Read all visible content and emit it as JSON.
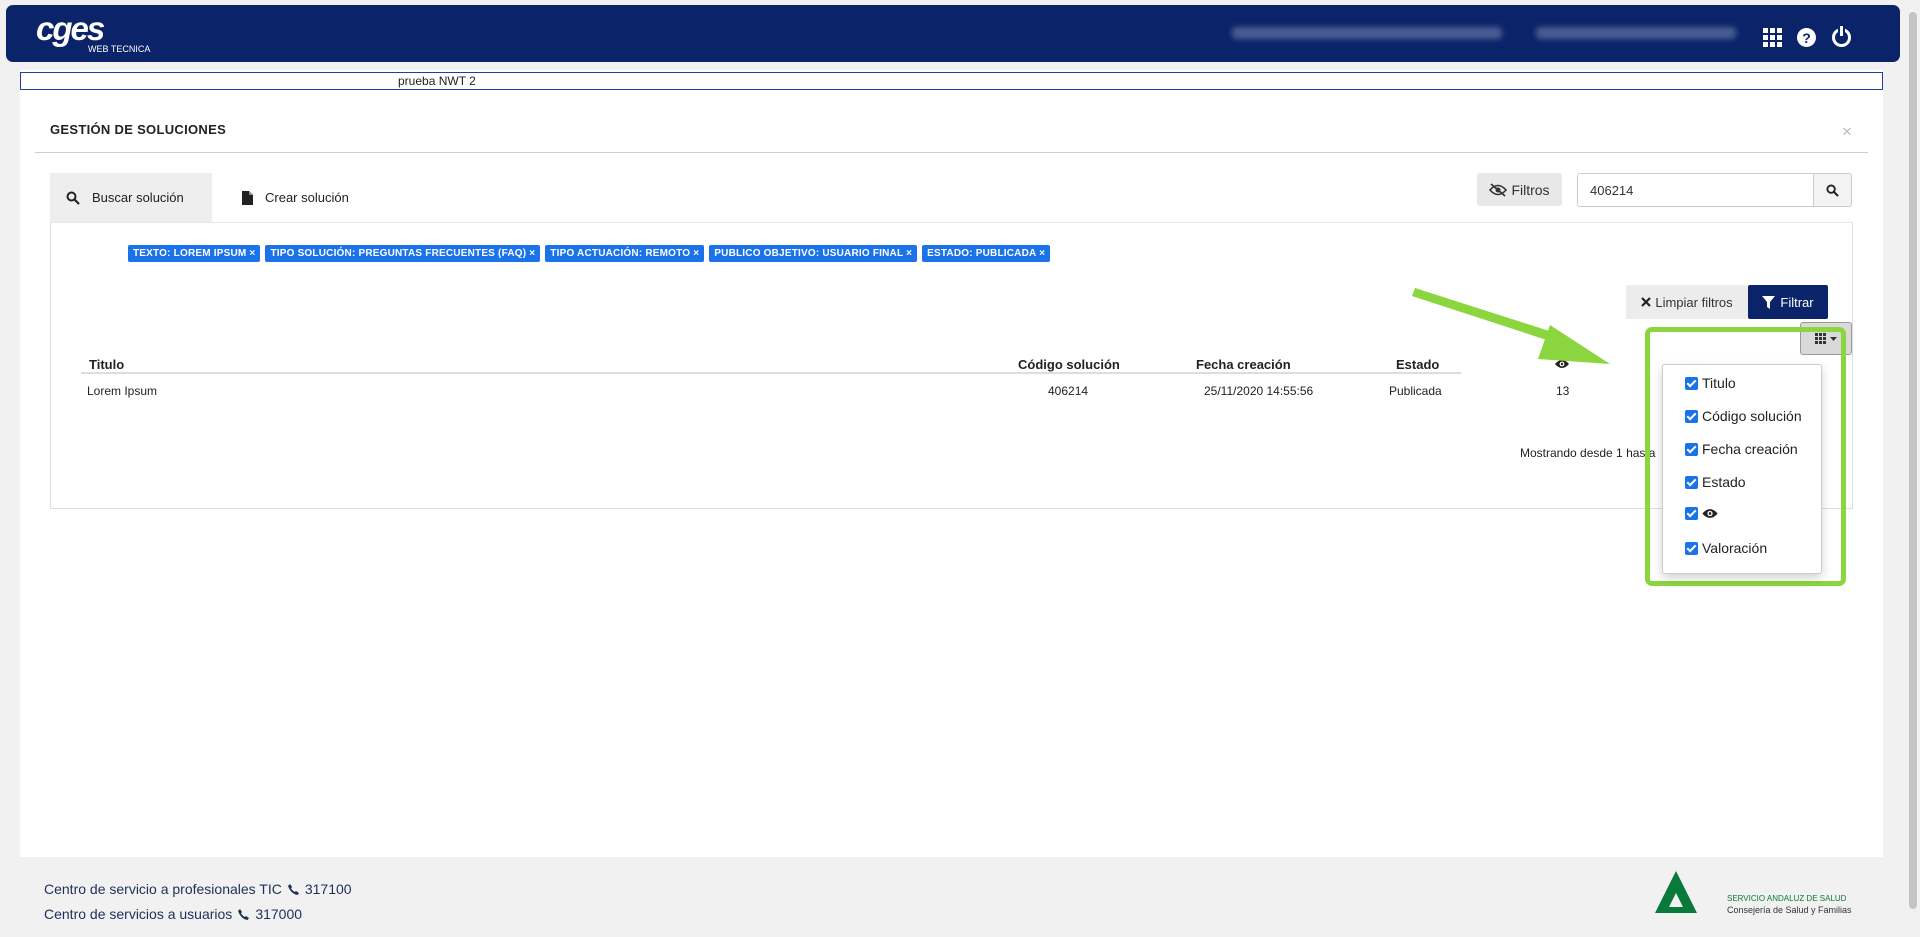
{
  "header": {
    "logo_text": "cges",
    "logo_sub": "WEB TECNICA",
    "icons": [
      "apps-grid-icon",
      "help-icon",
      "power-icon"
    ]
  },
  "tab_banner": "prueba NWT 2",
  "page": {
    "title": "GESTIÓN DE SOLUCIONES",
    "close": "×"
  },
  "tabs": [
    {
      "label": "Buscar solución",
      "icon": "search-icon",
      "active": true
    },
    {
      "label": "Crear solución",
      "icon": "file-icon",
      "active": false
    }
  ],
  "search": {
    "filters_label": "Filtros",
    "value": "406214"
  },
  "chips": [
    "TEXTO: LOREM IPSUM",
    "TIPO SOLUCIÓN: PREGUNTAS FRECUENTES (FAQ)",
    "TIPO ACTUACIÓN: REMOTO",
    "PUBLICO OBJETIVO: USUARIO FINAL",
    "ESTADO: PUBLICADA"
  ],
  "chip_close": "×",
  "actions": {
    "clear_label": "Limpiar filtros",
    "filter_label": "Filtrar"
  },
  "table": {
    "headers": [
      "Titulo",
      "Código solución",
      "Fecha creación",
      "Estado",
      ""
    ],
    "rows": [
      [
        "Lorem Ipsum",
        "406214",
        "25/11/2020 14:55:56",
        "Publicada",
        "13"
      ]
    ],
    "showing": "Mostrando desde 1 hasta"
  },
  "column_menu": [
    {
      "label": "Titulo",
      "checked": true
    },
    {
      "label": "Código solución",
      "checked": true
    },
    {
      "label": "Fecha creación",
      "checked": true
    },
    {
      "label": "Estado",
      "checked": true
    },
    {
      "label": "",
      "icon": "eye-icon",
      "checked": true
    },
    {
      "label": "Valoración",
      "checked": true
    }
  ],
  "footer": {
    "line1_text": "Centro de servicio a profesionales TIC",
    "line1_phone": "317100",
    "line2_text": "Centro de servicios a usuarios",
    "line2_phone": "317000",
    "logo_line1": "SERVICIO ANDALUZ DE SALUD",
    "logo_line2": "Consejería de Salud y Familias"
  },
  "colors": {
    "header": "#0b2368",
    "chip": "#1a73e8",
    "highlight": "#8bd53e",
    "sas_green": "#0a7a3a"
  }
}
